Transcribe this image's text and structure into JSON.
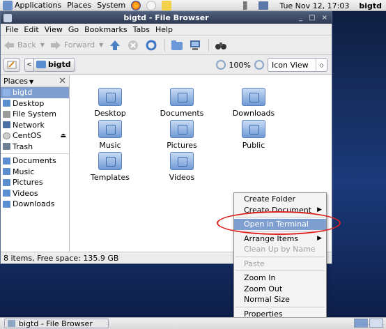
{
  "top_panel": {
    "menus": [
      "Applications",
      "Places",
      "System"
    ],
    "datetime": "Tue Nov 12, 17:03",
    "user": "bigtd"
  },
  "window": {
    "title": "bigtd - File Browser",
    "controls": [
      "_",
      "□",
      "×"
    ]
  },
  "menubar": [
    "File",
    "Edit",
    "View",
    "Go",
    "Bookmarks",
    "Tabs",
    "Help"
  ],
  "toolbar": {
    "back_label": "Back",
    "forward_label": "Forward"
  },
  "location": {
    "crumb": "bigtd",
    "zoom": "100%",
    "view_mode": "Icon View"
  },
  "sidebar": {
    "header": "Places",
    "places": [
      {
        "label": "bigtd",
        "icon": "home-icon",
        "selected": true
      },
      {
        "label": "Desktop",
        "icon": "folder-icon"
      },
      {
        "label": "File System",
        "icon": "drive-icon"
      },
      {
        "label": "Network",
        "icon": "network-icon"
      },
      {
        "label": "CentOS",
        "icon": "disc-icon",
        "eject": true
      },
      {
        "label": "Trash",
        "icon": "trash-icon"
      }
    ],
    "bookmarks": [
      {
        "label": "Documents",
        "icon": "folder-icon"
      },
      {
        "label": "Music",
        "icon": "folder-icon"
      },
      {
        "label": "Pictures",
        "icon": "folder-icon"
      },
      {
        "label": "Videos",
        "icon": "folder-icon"
      },
      {
        "label": "Downloads",
        "icon": "folder-icon"
      }
    ]
  },
  "files": [
    {
      "label": "Desktop",
      "icon": "desktop-folder-icon"
    },
    {
      "label": "Documents",
      "icon": "documents-folder-icon"
    },
    {
      "label": "Downloads",
      "icon": "downloads-folder-icon"
    },
    {
      "label": "Music",
      "icon": "music-folder-icon"
    },
    {
      "label": "Pictures",
      "icon": "pictures-folder-icon"
    },
    {
      "label": "Public",
      "icon": "public-folder-icon"
    },
    {
      "label": "Templates",
      "icon": "templates-folder-icon"
    },
    {
      "label": "Videos",
      "icon": "videos-folder-icon"
    }
  ],
  "status": "8 items, Free space: 135.9 GB",
  "context_menu": {
    "items": [
      {
        "label": "Create Folder"
      },
      {
        "label": "Create Document",
        "submenu": true
      },
      {
        "sep": true
      },
      {
        "label": "Open in Terminal",
        "selected": true
      },
      {
        "sep": true
      },
      {
        "label": "Arrange Items",
        "submenu": true
      },
      {
        "label": "Clean Up by Name",
        "disabled": true
      },
      {
        "sep": true
      },
      {
        "label": "Paste",
        "disabled": true
      },
      {
        "sep": true
      },
      {
        "label": "Zoom In"
      },
      {
        "label": "Zoom Out"
      },
      {
        "label": "Normal Size"
      },
      {
        "sep": true
      },
      {
        "label": "Properties"
      }
    ]
  },
  "taskbar": {
    "window_button": "bigtd - File Browser"
  },
  "colors": {
    "selection": "#7f9fd0",
    "highlight_ring": "#e0201b",
    "titlebar": "#2e3a55"
  }
}
